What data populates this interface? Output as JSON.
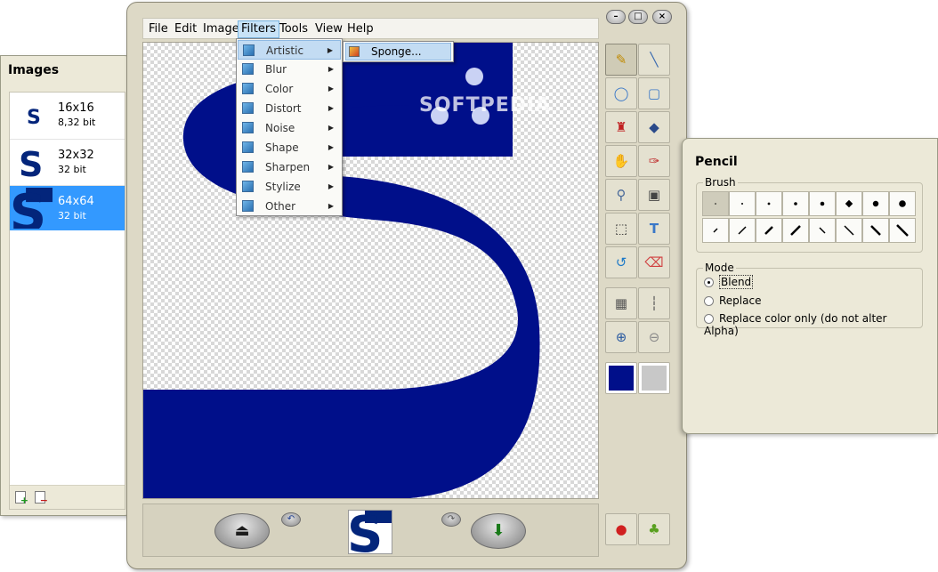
{
  "images_panel": {
    "title": "Images",
    "items": [
      {
        "size": "16x16",
        "bits": "8,32 bit"
      },
      {
        "size": "32x32",
        "bits": "32 bit"
      },
      {
        "size": "64x64",
        "bits": "32 bit"
      }
    ],
    "selected_index": 2
  },
  "menubar": {
    "items": [
      "File",
      "Edit",
      "Image",
      "Filters",
      "Tools",
      "View",
      "Help"
    ],
    "active": "Filters"
  },
  "filters_menu": {
    "items": [
      "Artistic",
      "Blur",
      "Color",
      "Distort",
      "Noise",
      "Shape",
      "Sharpen",
      "Stylize",
      "Other"
    ],
    "highlighted": "Artistic",
    "submenu_items": [
      "Sponge..."
    ]
  },
  "watermark": "SOFTPEDIA",
  "colors": {
    "primary": "#000f8a",
    "secondary": "#c8c8c8",
    "icon_blue": "#03257b",
    "accent_selection": "#3399ff"
  },
  "tools": [
    "pencil-icon",
    "line-icon",
    "ellipse-icon",
    "rounded-rect-icon",
    "spray-icon",
    "fill-bucket-icon",
    "hand-icon",
    "color-picker-icon",
    "magnifier-icon",
    "stamp-icon",
    "select-rect-icon",
    "text-icon",
    "rotate-icon",
    "eraser-icon",
    "grid-icon",
    "ruler-icon",
    "zoom-in-icon",
    "zoom-out-icon"
  ],
  "pencil_panel": {
    "title": "Pencil",
    "brush_label": "Brush",
    "mode_label": "Mode",
    "modes": [
      "Blend",
      "Replace",
      "Replace color only (do not alter Alpha)"
    ],
    "selected_mode": "Blend"
  }
}
